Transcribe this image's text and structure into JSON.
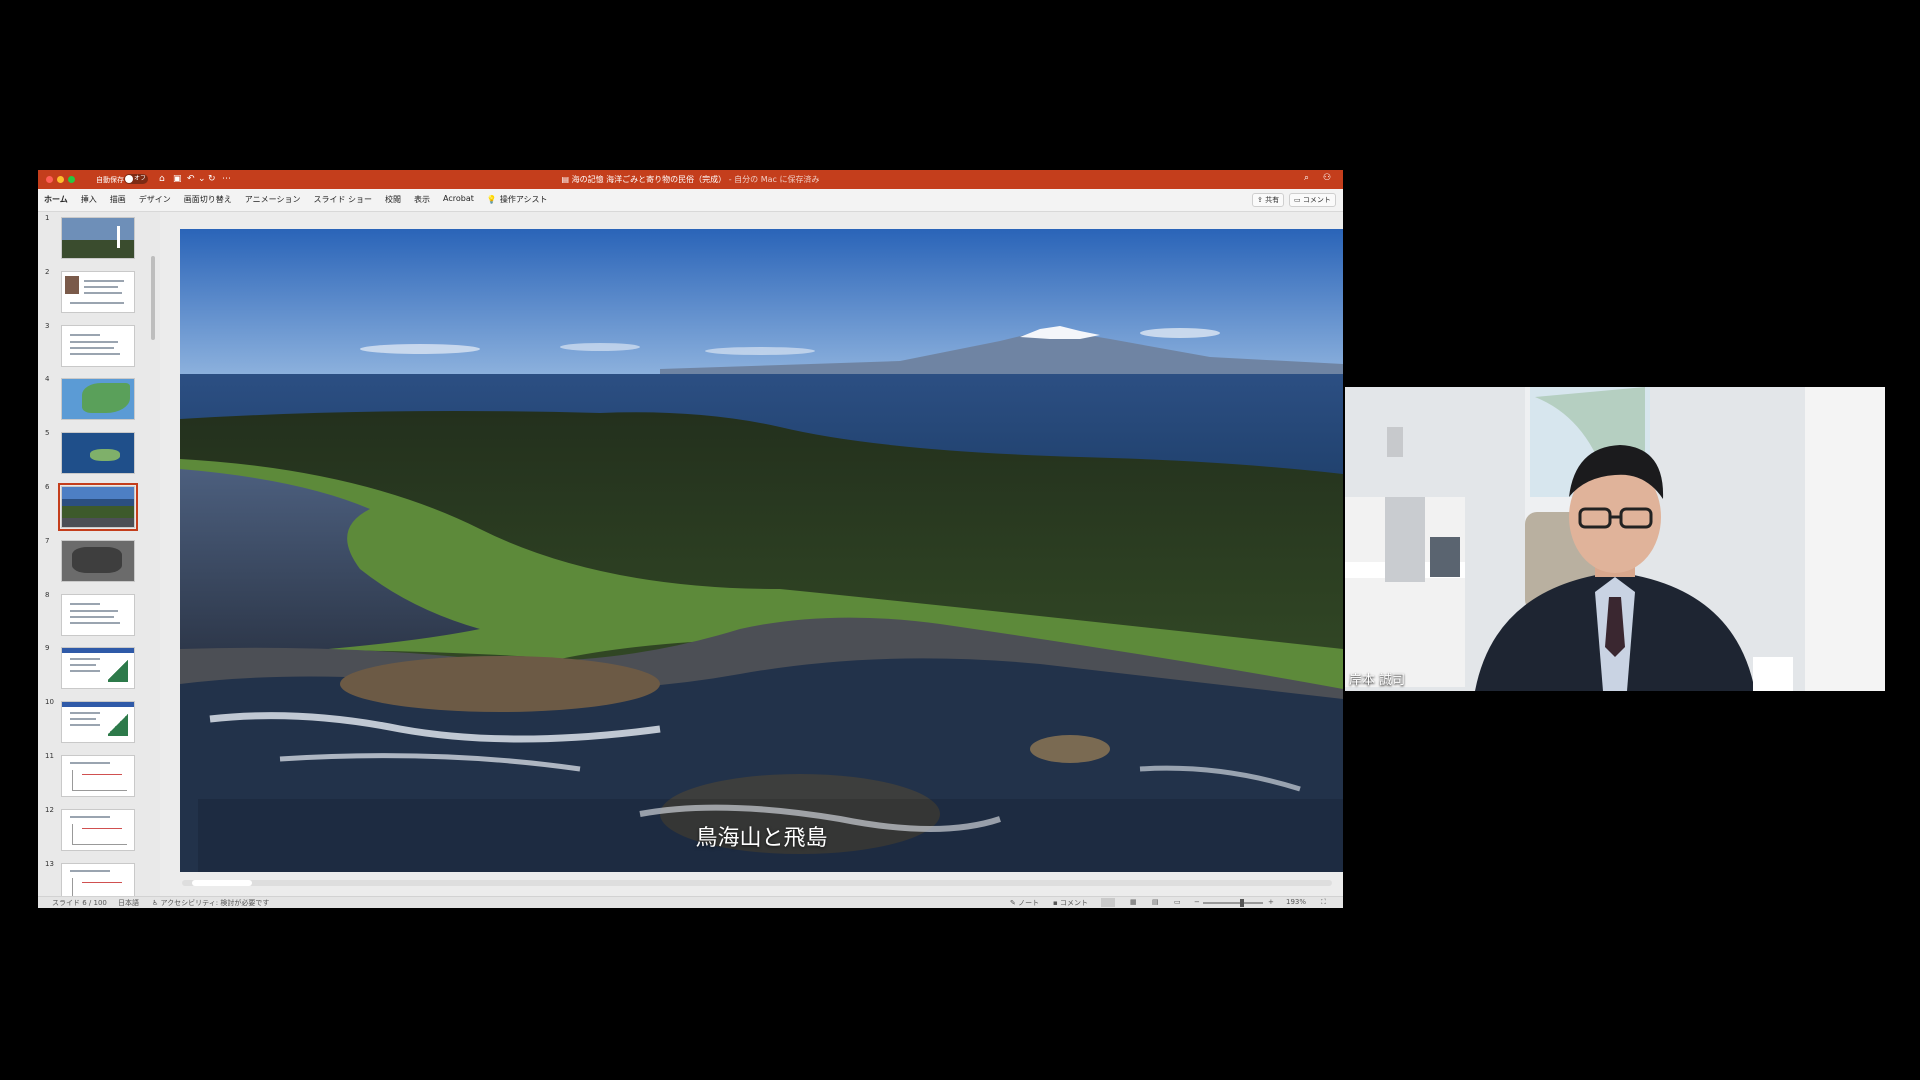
{
  "window": {
    "autosave_label": "自動保存",
    "autosave_state": "オフ",
    "file_icon": "document-icon",
    "title": "海の記憶 海洋ごみと寄り物の民俗（完成）",
    "title_status": " - 自分の Mac に保存済み",
    "accent_color": "#c43e1c"
  },
  "ribbon": {
    "tabs": [
      "ホーム",
      "挿入",
      "描画",
      "デザイン",
      "画面切り替え",
      "アニメーション",
      "スライド ショー",
      "校閲",
      "表示",
      "Acrobat"
    ],
    "tell_me": "操作アシスト",
    "share_label": "共有",
    "comments_label": "コメント"
  },
  "thumbnails": [
    {
      "num": "1",
      "kind": "photo"
    },
    {
      "num": "2",
      "kind": "text-photo"
    },
    {
      "num": "3",
      "kind": "text"
    },
    {
      "num": "4",
      "kind": "map"
    },
    {
      "num": "5",
      "kind": "map-dark"
    },
    {
      "num": "6",
      "kind": "photo-island",
      "selected": true
    },
    {
      "num": "7",
      "kind": "photo-rocks"
    },
    {
      "num": "8",
      "kind": "text"
    },
    {
      "num": "9",
      "kind": "chart"
    },
    {
      "num": "10",
      "kind": "chart"
    },
    {
      "num": "11",
      "kind": "graph"
    },
    {
      "num": "12",
      "kind": "graph"
    },
    {
      "num": "13",
      "kind": "graph"
    }
  ],
  "slide": {
    "caption": "鳥海山と飛島"
  },
  "status": {
    "slide_position": "スライド 6 / 100",
    "language": "日本語",
    "accessibility": "アクセシビリティ: 検討が必要です",
    "notes_label": "ノート",
    "comments_label": "コメント",
    "zoom": "193%"
  },
  "video": {
    "participant_name": "岸本 誠司"
  }
}
